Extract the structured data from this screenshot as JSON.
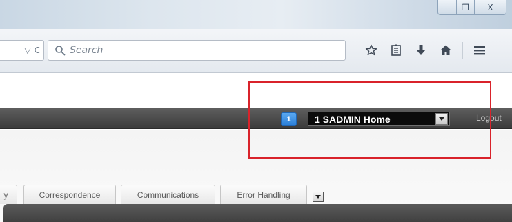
{
  "window": {
    "controls": {
      "minimize": "—",
      "maximize": "❐",
      "close": "X"
    }
  },
  "navbar": {
    "url_icons": {
      "dropdown": "▽",
      "reload": "C"
    },
    "search": {
      "placeholder": "Search",
      "icon": "magnifier-icon"
    },
    "icons": [
      "star-bookmark-icon",
      "reading-list-icon",
      "download-arrow-icon",
      "home-icon",
      "hamburger-menu-icon"
    ]
  },
  "appbar": {
    "notification_count": "1",
    "home_select_value": "1 SADMIN Home",
    "logout_label": "Logout"
  },
  "tabs": [
    {
      "label": "y"
    },
    {
      "label": "Correspondence"
    },
    {
      "label": "Communications"
    },
    {
      "label": "Error Handling"
    }
  ],
  "annotation": {
    "color": "#d9232b"
  }
}
